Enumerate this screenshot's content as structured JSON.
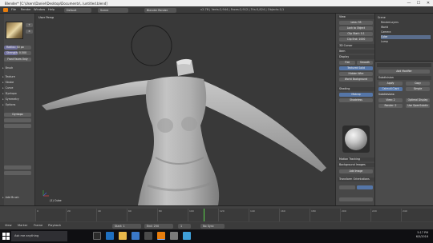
{
  "window": {
    "title": "Blender* [C:\\Users\\Daniel\\Desktop\\Documents\\..\\untitled.blend]",
    "minimize": "—",
    "maximize": "☐",
    "close": "✕"
  },
  "infobar": {
    "menus": [
      "File",
      "Render",
      "Window",
      "Help"
    ],
    "screen": "Default",
    "scene": "Scene",
    "engine": "Blender Render",
    "stats": "v2.78 | Verts:2,944 | Faces:2,912 | Tris:5,824 | Objects:1/1"
  },
  "toolshelf": {
    "panels": [
      "Brush",
      "Texture",
      "Stroke",
      "Curve",
      "Dyntopo",
      "Symmetry",
      "Options"
    ],
    "sliders": [
      {
        "label": "Radius: 50 px",
        "fraction": 0.5
      },
      {
        "label": "Strength: 0.500",
        "fraction": 0.5
      }
    ],
    "button": "Front Faces Only",
    "extra": "Dyntopo",
    "redo": "Add Brush"
  },
  "viewport": {
    "view_label": "User Persp",
    "object_label": "(1) Cube",
    "accent_ring": "#1c1c1c",
    "mesh_color": "#b5b5b5"
  },
  "props": {
    "tabs": [
      "View",
      "3D Cursor",
      "Item",
      "Display",
      "Shading",
      "Motion Tracking",
      "Background Images",
      "Transform Orientations"
    ],
    "buttons": [
      "Flat",
      "Smooth",
      "Matcap",
      "Shadeless",
      "Textured Solid",
      "World Background",
      "Hidden Wire",
      "Add Image"
    ],
    "values": [
      "Lens: 35",
      "Clip Start: 0.1",
      "Clip End: 1000",
      "Lock to Object"
    ]
  },
  "outliner": {
    "rows": [
      "Scene",
      "RenderLayers",
      "World",
      "Camera",
      "Cube",
      "Lamp"
    ],
    "selected_index": 4
  },
  "modifiers": {
    "header": "Add Modifier",
    "name": "Subdivision",
    "rows": [
      "Apply",
      "Copy",
      "Simple",
      "Catmull-Clark",
      "Subdivisions:",
      "View: 2",
      "Render: 2",
      "Optimal Display",
      "Use OpenSubdiv"
    ],
    "tabs_color": "#5576a8"
  },
  "timeline": {
    "ticks": [
      "0",
      "20",
      "40",
      "60",
      "80",
      "100",
      "120",
      "140",
      "160",
      "180",
      "200",
      "220",
      "240"
    ],
    "controls": [
      "View",
      "Marker",
      "Frame",
      "Playback",
      "Start: 1",
      "End: 250",
      "1",
      "No Sync"
    ],
    "playhead_color": "#5bd34a"
  },
  "taskbar": {
    "search_placeholder": "Ask me anything",
    "time": "5:17 PM",
    "date": "6/5/2016"
  }
}
